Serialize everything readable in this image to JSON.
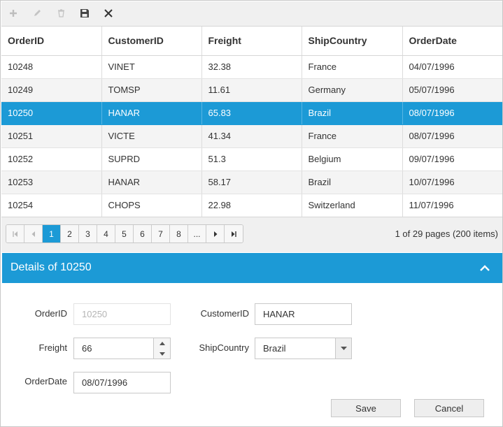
{
  "toolbar": {
    "buttons": [
      {
        "icon": "add-icon",
        "enabled": false
      },
      {
        "icon": "edit-icon",
        "enabled": false
      },
      {
        "icon": "delete-icon",
        "enabled": false
      },
      {
        "icon": "save-icon",
        "enabled": true
      },
      {
        "icon": "cancel-icon",
        "enabled": true
      }
    ]
  },
  "grid": {
    "columns": [
      "OrderID",
      "CustomerID",
      "Freight",
      "ShipCountry",
      "OrderDate"
    ],
    "rows": [
      [
        "10248",
        "VINET",
        "32.38",
        "France",
        "04/07/1996"
      ],
      [
        "10249",
        "TOMSP",
        "11.61",
        "Germany",
        "05/07/1996"
      ],
      [
        "10250",
        "HANAR",
        "65.83",
        "Brazil",
        "08/07/1996"
      ],
      [
        "10251",
        "VICTE",
        "41.34",
        "France",
        "08/07/1996"
      ],
      [
        "10252",
        "SUPRD",
        "51.3",
        "Belgium",
        "09/07/1996"
      ],
      [
        "10253",
        "HANAR",
        "58.17",
        "Brazil",
        "10/07/1996"
      ],
      [
        "10254",
        "CHOPS",
        "22.98",
        "Switzerland",
        "11/07/1996"
      ]
    ],
    "selected_row": 2
  },
  "pager": {
    "pages": [
      "1",
      "2",
      "3",
      "4",
      "5",
      "6",
      "7",
      "8",
      "..."
    ],
    "current_page": "1",
    "info": "1 of 29 pages (200 items)"
  },
  "details": {
    "title": "Details of 10250",
    "labels": {
      "order_id": "OrderID",
      "customer_id": "CustomerID",
      "freight": "Freight",
      "ship_country": "ShipCountry",
      "order_date": "OrderDate"
    },
    "values": {
      "order_id": "10250",
      "customer_id": "HANAR",
      "freight": "66",
      "ship_country": "Brazil",
      "order_date": "08/07/1996"
    },
    "save_label": "Save",
    "cancel_label": "Cancel"
  },
  "colors": {
    "accent": "#1c9ad6",
    "toolbar_bg": "#f0f0f0",
    "alt_row": "#f4f4f4"
  }
}
